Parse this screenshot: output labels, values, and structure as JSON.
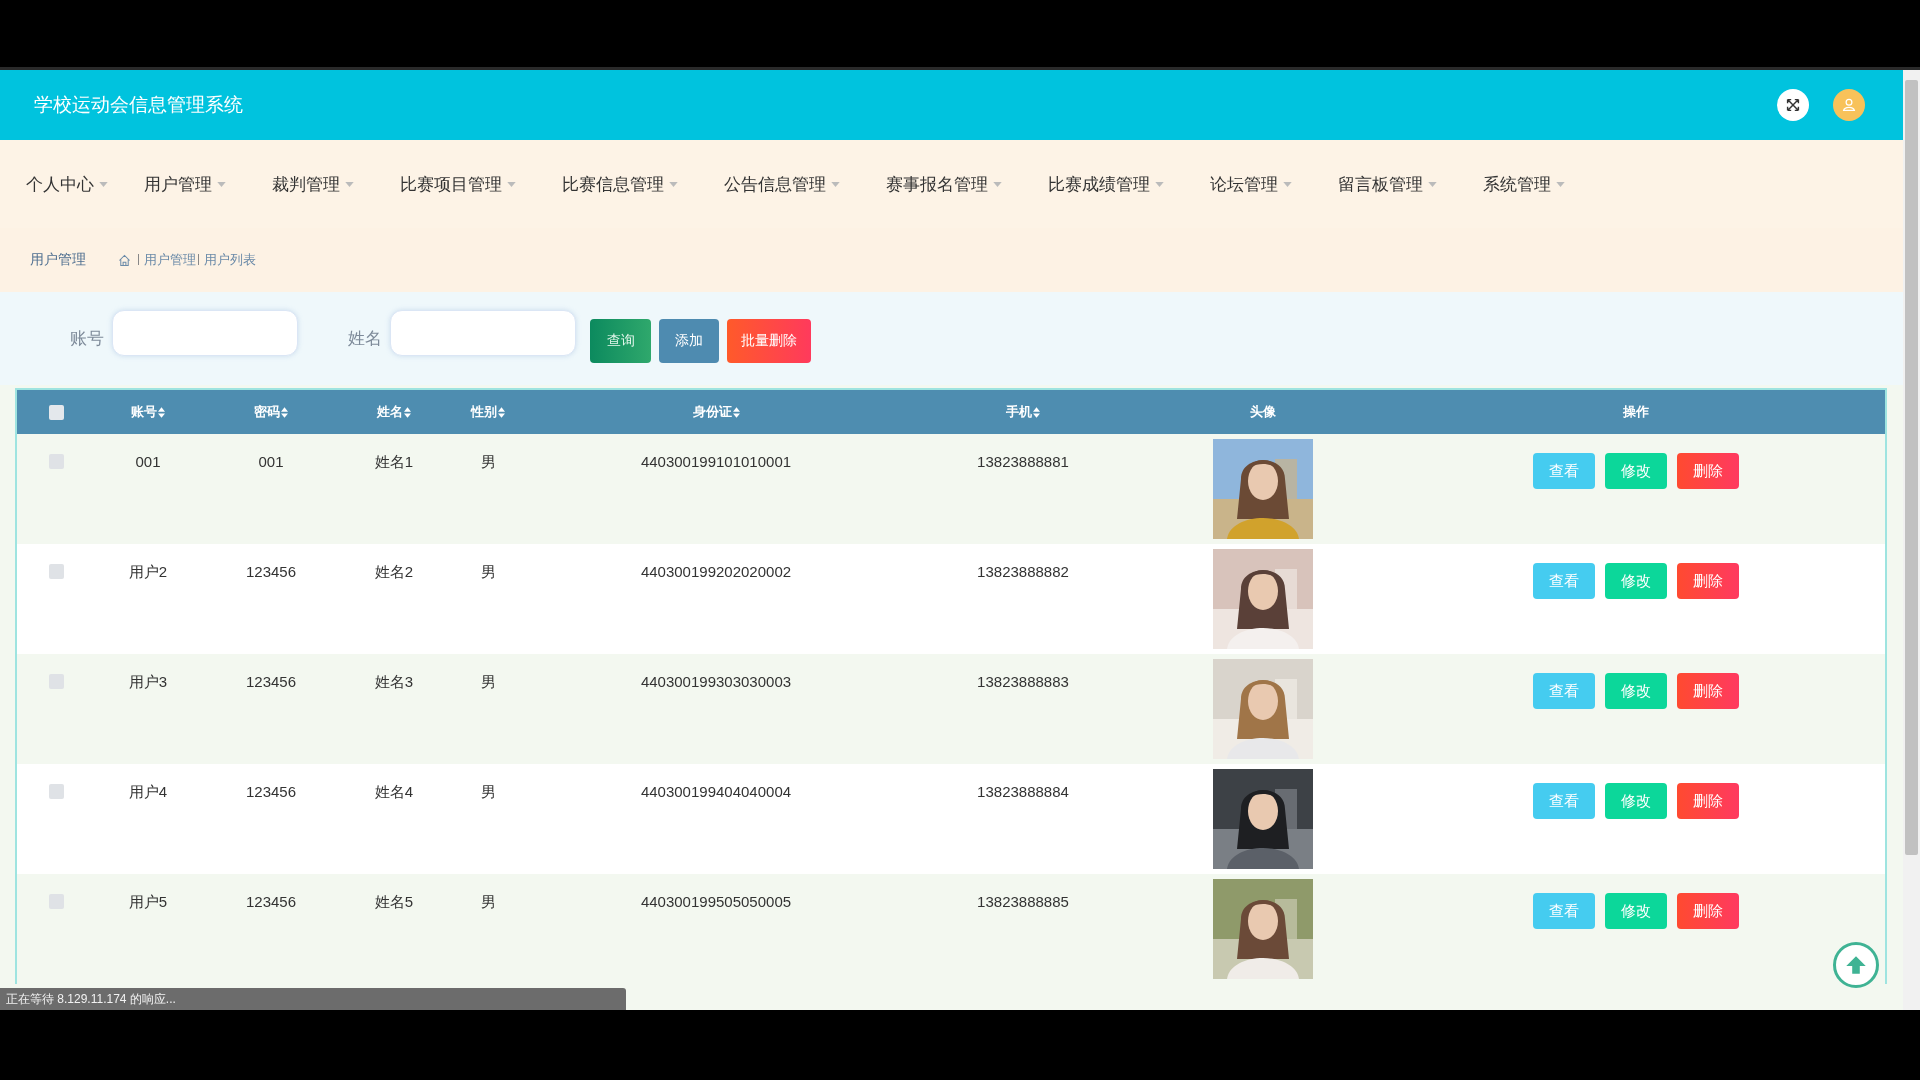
{
  "header": {
    "title": "学校运动会信息管理系统"
  },
  "nav": [
    {
      "label": "个人中心"
    },
    {
      "label": "用户管理"
    },
    {
      "label": "裁判管理"
    },
    {
      "label": "比赛项目管理"
    },
    {
      "label": "比赛信息管理"
    },
    {
      "label": "公告信息管理"
    },
    {
      "label": "赛事报名管理"
    },
    {
      "label": "比赛成绩管理"
    },
    {
      "label": "论坛管理"
    },
    {
      "label": "留言板管理"
    },
    {
      "label": "系统管理"
    }
  ],
  "breadcrumb": {
    "title": "用户管理",
    "path": [
      "用户管理",
      "用户列表"
    ]
  },
  "search": {
    "fields": [
      {
        "label": "账号"
      },
      {
        "label": "姓名"
      }
    ],
    "buttons": [
      {
        "kind": "search",
        "label": "查询"
      },
      {
        "kind": "add",
        "label": "添加"
      },
      {
        "kind": "batch-delete",
        "label": "批量删除"
      }
    ]
  },
  "table": {
    "select_all": {
      "checked": false
    },
    "columns": [
      {
        "label": "账号",
        "sortable": true
      },
      {
        "label": "密码",
        "sortable": true
      },
      {
        "label": "姓名",
        "sortable": true
      },
      {
        "label": "性别",
        "sortable": true
      },
      {
        "label": "身份证",
        "sortable": true
      },
      {
        "label": "手机",
        "sortable": true
      },
      {
        "label": "头像",
        "sortable": false
      },
      {
        "label": "操作",
        "sortable": false
      }
    ],
    "rows": [
      {
        "checked": false,
        "cells": [
          "001",
          "001",
          "姓名1",
          "男",
          "440300199101010001",
          "13823888881"
        ],
        "actions": [
          {
            "kind": "view",
            "label": "查看"
          },
          {
            "kind": "edit",
            "label": "修改"
          },
          {
            "kind": "delete",
            "label": "删除"
          }
        ]
      },
      {
        "checked": false,
        "cells": [
          "用户2",
          "123456",
          "姓名2",
          "男",
          "440300199202020002",
          "13823888882"
        ],
        "actions": [
          {
            "kind": "view",
            "label": "查看"
          },
          {
            "kind": "edit",
            "label": "修改"
          },
          {
            "kind": "delete",
            "label": "删除"
          }
        ]
      },
      {
        "checked": false,
        "cells": [
          "用户3",
          "123456",
          "姓名3",
          "男",
          "440300199303030003",
          "13823888883"
        ],
        "actions": [
          {
            "kind": "view",
            "label": "查看"
          },
          {
            "kind": "edit",
            "label": "修改"
          },
          {
            "kind": "delete",
            "label": "删除"
          }
        ]
      },
      {
        "checked": false,
        "cells": [
          "用户4",
          "123456",
          "姓名4",
          "男",
          "440300199404040004",
          "13823888884"
        ],
        "actions": [
          {
            "kind": "view",
            "label": "查看"
          },
          {
            "kind": "edit",
            "label": "修改"
          },
          {
            "kind": "delete",
            "label": "删除"
          }
        ]
      },
      {
        "checked": false,
        "cells": [
          "用户5",
          "123456",
          "姓名5",
          "男",
          "440300199505050005",
          "13823888885"
        ],
        "actions": [
          {
            "kind": "view",
            "label": "查看"
          },
          {
            "kind": "edit",
            "label": "修改"
          },
          {
            "kind": "delete",
            "label": "删除"
          }
        ]
      }
    ]
  },
  "status_bar": {
    "text": "正在等待 8.129.11.174 的响应..."
  }
}
